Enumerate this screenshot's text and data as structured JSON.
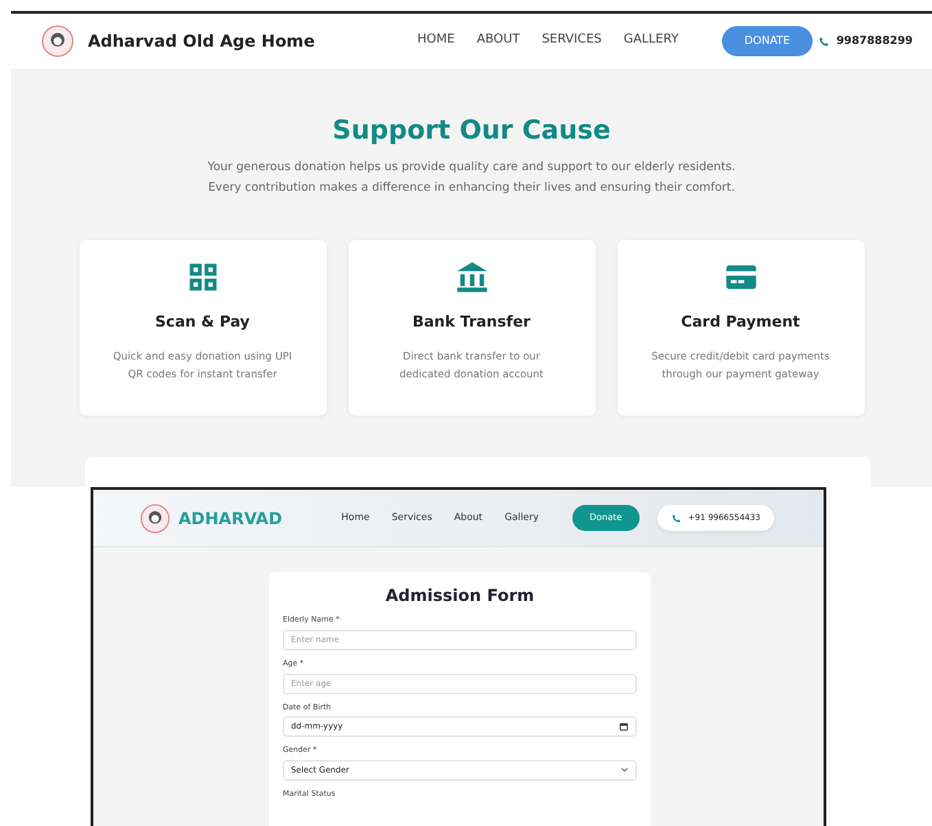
{
  "donation_page": {
    "brand": "Adharvad Old Age Home",
    "nav": [
      {
        "label": "HOME",
        "kind": "link"
      },
      {
        "label": "ABOUT",
        "kind": "link"
      },
      {
        "label": "SERVICES",
        "kind": "link"
      },
      {
        "label": "GALLERY",
        "kind": "link"
      },
      {
        "label": "DONATE",
        "kind": "button"
      }
    ],
    "phone": "9987888299",
    "title": "Support Our Cause",
    "intro": "Your generous donation helps us provide quality care and support to our elderly residents.\nEvery contribution makes a difference in enhancing their lives and ensuring their comfort.",
    "methods": [
      {
        "kind": "qr",
        "title": "Scan & Pay",
        "text": "Quick and easy donation using UPI QR codes for instant transfer"
      },
      {
        "kind": "bank",
        "title": "Bank Transfer",
        "text": "Direct bank transfer to our dedicated donation account"
      },
      {
        "kind": "card",
        "title": "Card Payment",
        "text": "Secure credit/debit card payments through our payment gateway"
      }
    ]
  },
  "admission_page": {
    "brand": "ADHARVAD",
    "nav": [
      {
        "label": "Home",
        "kind": "link"
      },
      {
        "label": "Services",
        "kind": "link"
      },
      {
        "label": "About",
        "kind": "link"
      },
      {
        "label": "Gallery",
        "kind": "link"
      },
      {
        "label": "Donate",
        "kind": "button"
      }
    ],
    "phone": "+91 9966554433",
    "form_title": "Admission Form",
    "fields": [
      {
        "kind": "text",
        "label": "Elderly Name *",
        "placeholder": "Enter name"
      },
      {
        "kind": "text",
        "label": "Age *",
        "placeholder": "Enter age"
      },
      {
        "kind": "date",
        "label": "Date of Birth",
        "value": "dd-mm-yyyy"
      },
      {
        "kind": "select",
        "label": "Gender *",
        "value": "Select Gender"
      },
      {
        "kind": "label",
        "label": "Marital Status"
      }
    ]
  }
}
